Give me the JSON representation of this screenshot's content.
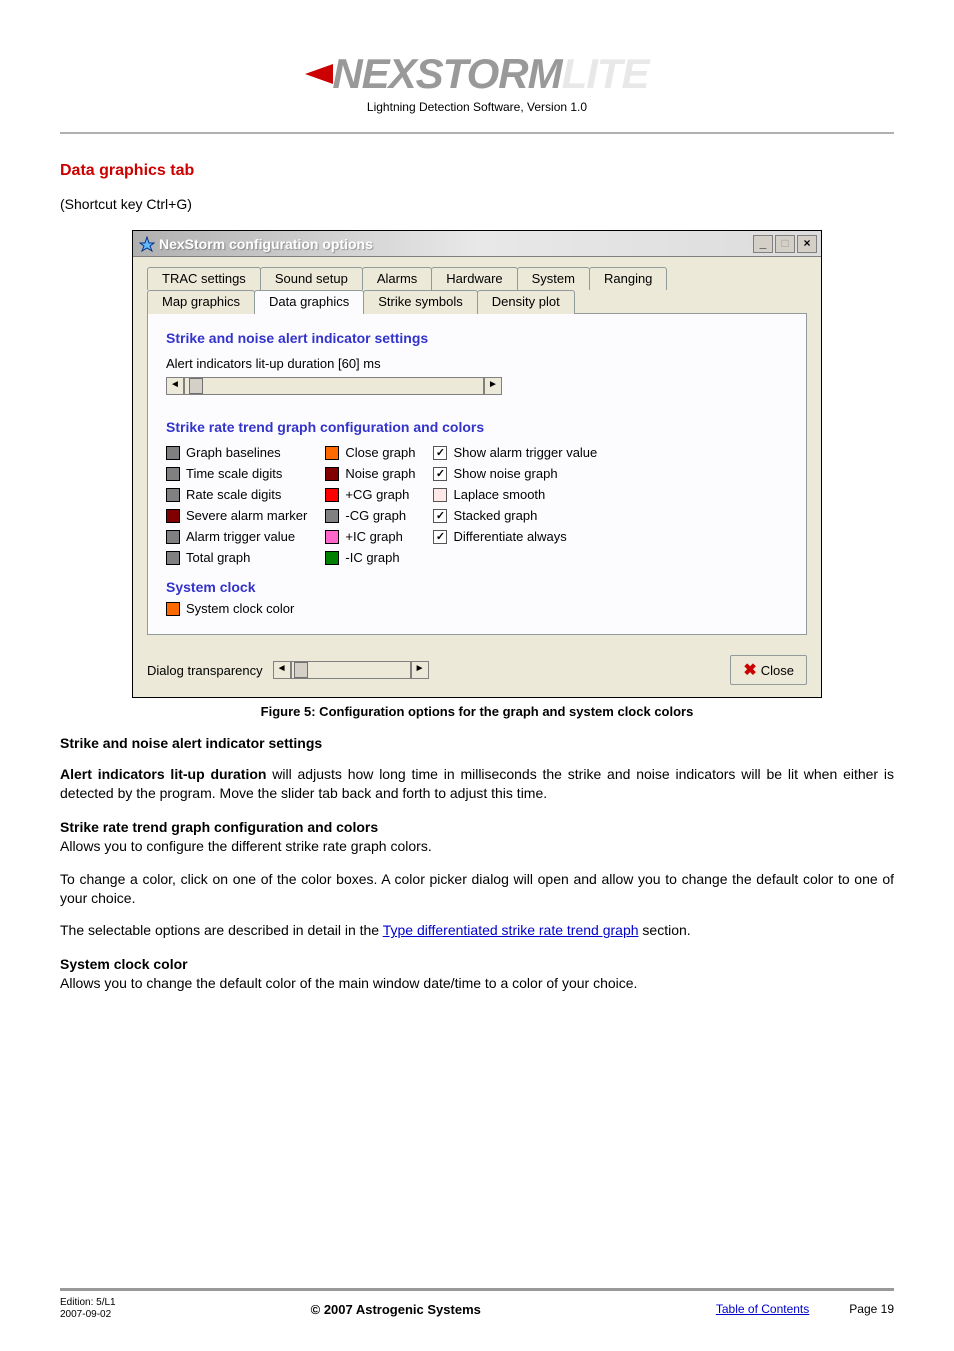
{
  "header": {
    "logo_dark": "NEXSTORM",
    "logo_light": "LITE",
    "subtitle": "Lightning Detection Software, Version 1.0"
  },
  "section": {
    "title": "Data graphics tab",
    "shortcut": "(Shortcut key Ctrl+G)"
  },
  "dialog": {
    "title": "NexStorm configuration options",
    "tabs_row1": [
      "TRAC settings",
      "Sound setup",
      "Alarms",
      "Hardware",
      "System",
      "Ranging"
    ],
    "tabs_row2": [
      "Map graphics",
      "Data graphics",
      "Strike symbols",
      "Density plot"
    ],
    "active_tab": "Data graphics",
    "group1_title": "Strike and noise alert indicator settings",
    "alert_label": "Alert indicators lit-up duration [60] ms",
    "group2_title": "Strike rate trend graph configuration and colors",
    "color_col1": [
      {
        "label": "Graph baselines",
        "color": "#808080"
      },
      {
        "label": "Time scale digits",
        "color": "#808080"
      },
      {
        "label": "Rate scale digits",
        "color": "#808080"
      },
      {
        "label": "Severe alarm marker",
        "color": "#800000"
      },
      {
        "label": "Alarm trigger value",
        "color": "#808080"
      },
      {
        "label": "Total graph",
        "color": "#808080"
      }
    ],
    "color_col2": [
      {
        "label": "Close graph",
        "color": "#ff6a00"
      },
      {
        "label": "Noise graph",
        "color": "#800000"
      },
      {
        "label": "+CG graph",
        "color": "#ff0000"
      },
      {
        "label": "-CG graph",
        "color": "#808080"
      },
      {
        "label": "+IC graph",
        "color": "#ff66cc"
      },
      {
        "label": "-IC graph",
        "color": "#008000"
      }
    ],
    "check_col": [
      {
        "label": "Show alarm trigger value",
        "checked": true
      },
      {
        "label": "Show noise graph",
        "checked": true
      },
      {
        "label": "Laplace smooth",
        "checked": false
      },
      {
        "label": "Stacked graph",
        "checked": true
      },
      {
        "label": "Differentiate always",
        "checked": true
      }
    ],
    "sys_clock_title": "System clock",
    "sys_clock_item": {
      "label": "System clock color",
      "color": "#ff6a00"
    },
    "footer_label": "Dialog transparency",
    "close_label": "Close"
  },
  "caption": "Figure 5: Configuration options for the graph and system clock colors",
  "body": {
    "h1": "Strike and noise alert indicator settings",
    "p1a": "Alert indicators lit-up duration",
    "p1b": " will adjusts how long time in milliseconds the strike and noise indicators will be lit when either is detected by the program. Move the slider tab back and forth to adjust this time.",
    "h2": "Strike rate trend graph configuration and colors",
    "p2": "Allows you to configure the different strike rate graph colors.",
    "p3": "To change a color, click on one of the color boxes. A color picker dialog will open and allow you to change the default color to one of your choice.",
    "p4a": "The selectable options are described in detail in the ",
    "p4link": "Type differentiated strike rate trend graph",
    "p4b": " section.",
    "h3": "System clock color",
    "p5": "Allows you to change the default color of the main window date/time to a color of your choice."
  },
  "footer": {
    "edition": "Edition: 5/L1",
    "date": "2007-09-02",
    "copyright": "© 2007 Astrogenic Systems",
    "toc": "Table of Contents",
    "page": "Page 19"
  }
}
